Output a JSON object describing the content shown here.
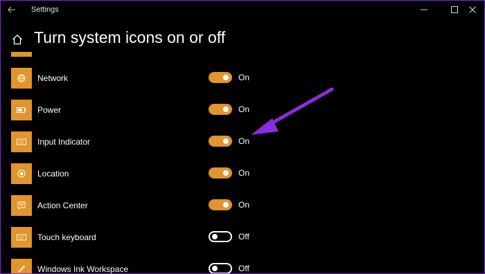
{
  "window": {
    "app_title": "Settings"
  },
  "page": {
    "title": "Turn system icons on or off"
  },
  "colors": {
    "accent": "#e1952c",
    "annotation_arrow": "#8b2be2",
    "window_border": "#7b2bd9"
  },
  "items": [
    {
      "label": "Network",
      "icon": "globe-icon",
      "toggle_on": true,
      "state_label": "On"
    },
    {
      "label": "Power",
      "icon": "battery-icon",
      "toggle_on": true,
      "state_label": "On"
    },
    {
      "label": "Input Indicator",
      "icon": "keyboard-icon",
      "toggle_on": true,
      "state_label": "On"
    },
    {
      "label": "Location",
      "icon": "location-icon",
      "toggle_on": true,
      "state_label": "On"
    },
    {
      "label": "Action Center",
      "icon": "action-center-icon",
      "toggle_on": true,
      "state_label": "On"
    },
    {
      "label": "Touch keyboard",
      "icon": "keyboard-icon",
      "toggle_on": false,
      "state_label": "Off"
    },
    {
      "label": "Windows Ink Workspace",
      "icon": "pen-icon",
      "toggle_on": false,
      "state_label": "Off"
    }
  ]
}
